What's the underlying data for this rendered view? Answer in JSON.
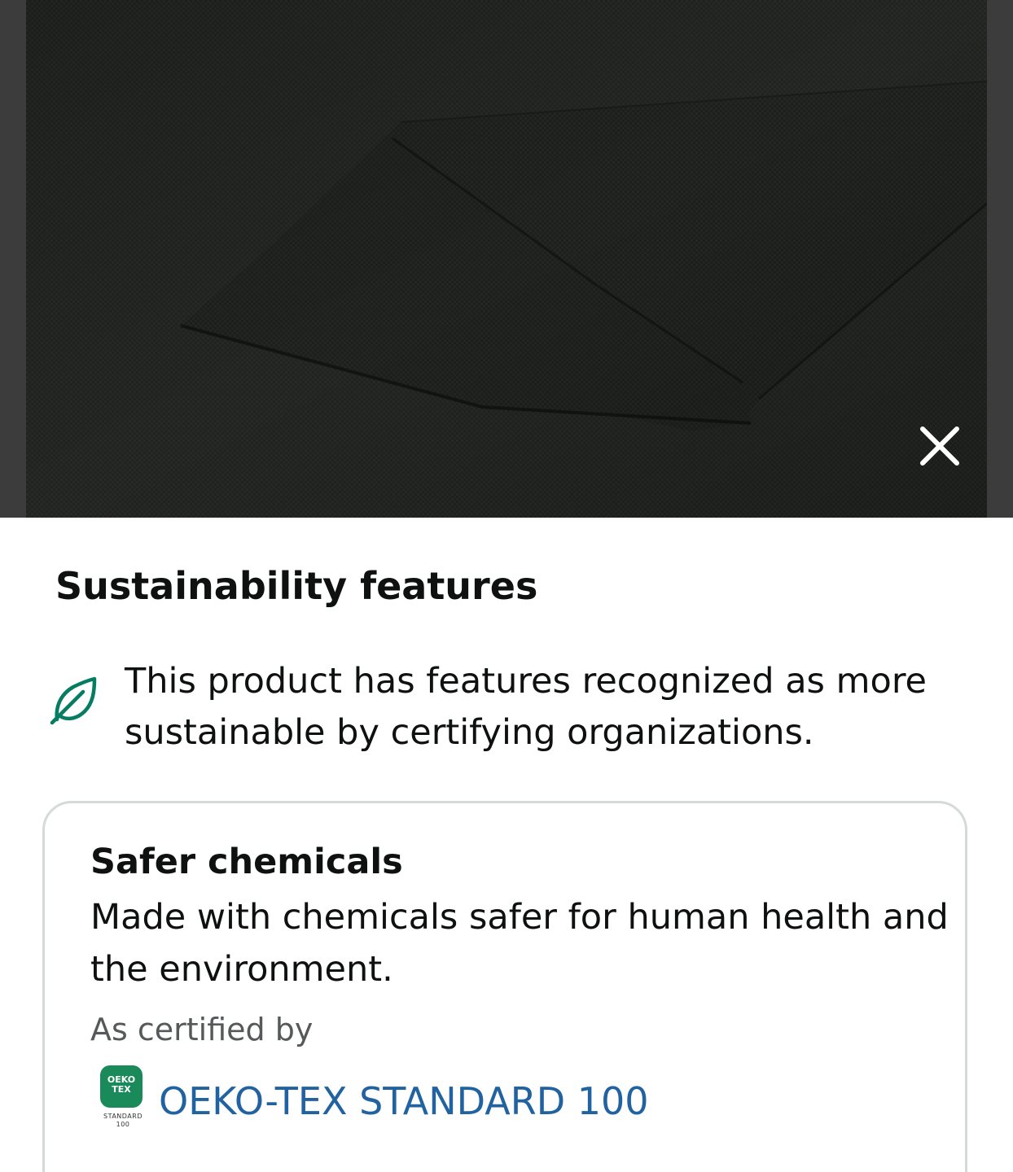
{
  "image": {
    "alt_icon": "product-fabric-photo",
    "close_icon": "close-icon"
  },
  "sheet": {
    "title": "Sustainability features",
    "intro": {
      "icon": "leaf-icon",
      "text": "This product has features recognized as more sustainable by certifying organizations."
    },
    "card": {
      "title": "Safer chemicals",
      "description": "Made with chemicals safer for human health and the environment.",
      "certified_by_label": "As certified by",
      "certification": {
        "logo_line1": "OEKO",
        "logo_line2": "TEX",
        "logo_sub1": "STANDARD",
        "logo_sub2": "100",
        "name": "OEKO-TEX STANDARD 100"
      }
    }
  },
  "colors": {
    "leaf_green": "#067d62",
    "link_blue": "#2162a1",
    "card_border": "#d5d9d9",
    "oeko_green": "#1a8a5a"
  }
}
